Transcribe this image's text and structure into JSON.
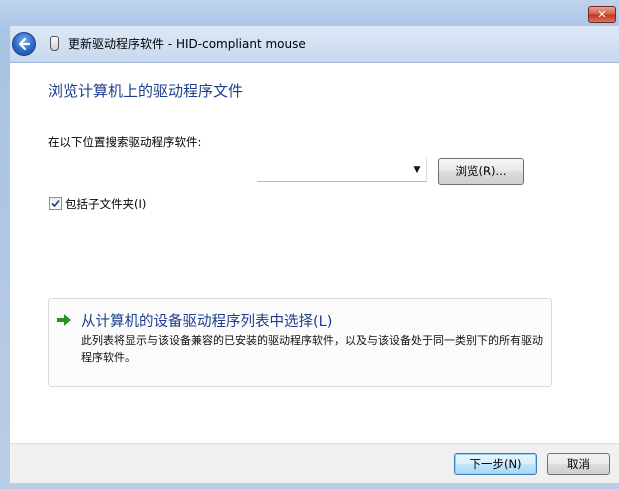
{
  "window": {
    "title": "更新驱动程序软件 - HID-compliant mouse",
    "close_label": "✕"
  },
  "page": {
    "heading": "浏览计算机上的驱动程序文件",
    "search_label": "在以下位置搜索驱动程序软件:",
    "path_value": "",
    "browse_label": "浏览(R)...",
    "include_subfolders_label": "包括子文件夹(I)",
    "include_subfolders_checked": true
  },
  "choice": {
    "title": "从计算机的设备驱动程序列表中选择(L)",
    "description": "此列表将显示与该设备兼容的已安装的驱动程序软件，以及与该设备处于同一类别下的所有驱动程序软件。"
  },
  "footer": {
    "next_label": "下一步(N)",
    "cancel_label": "取消"
  },
  "colors": {
    "heading": "#1e3d8f",
    "arrow": "#2f8f2f",
    "close": "#c4391f"
  },
  "icons": {
    "back": "back-arrow-icon",
    "window": "mouse-icon",
    "choice": "green-arrow-icon",
    "check": "checkmark-icon",
    "dropdown": "chevron-down-icon"
  }
}
